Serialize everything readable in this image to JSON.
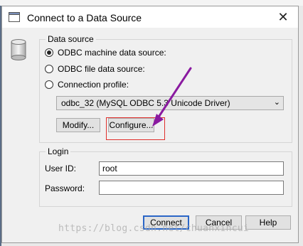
{
  "dialog": {
    "title": "Connect to a Data Source",
    "close_glyph": "✕"
  },
  "data_source": {
    "legend": "Data source",
    "options": [
      {
        "label": "ODBC machine data source:",
        "selected": true
      },
      {
        "label": "ODBC file data source:",
        "selected": false
      },
      {
        "label": "Connection profile:",
        "selected": false
      }
    ],
    "dropdown_value": "odbc_32 (MySQL ODBC 5.3 Unicode Driver)",
    "modify_label": "Modify...",
    "configure_label": "Configure..."
  },
  "login": {
    "legend": "Login",
    "userid_label": "User ID:",
    "userid_value": "root",
    "password_label": "Password:",
    "password_value": ""
  },
  "buttons": {
    "connect": "Connect",
    "cancel": "Cancel",
    "help": "Help"
  },
  "watermark": "https://blog.csdn.net/chuanxincui",
  "colors": {
    "annotation_arrow": "#8a1aa0",
    "highlight_box": "#e0302c",
    "default_button_border": "#2b66c7"
  }
}
